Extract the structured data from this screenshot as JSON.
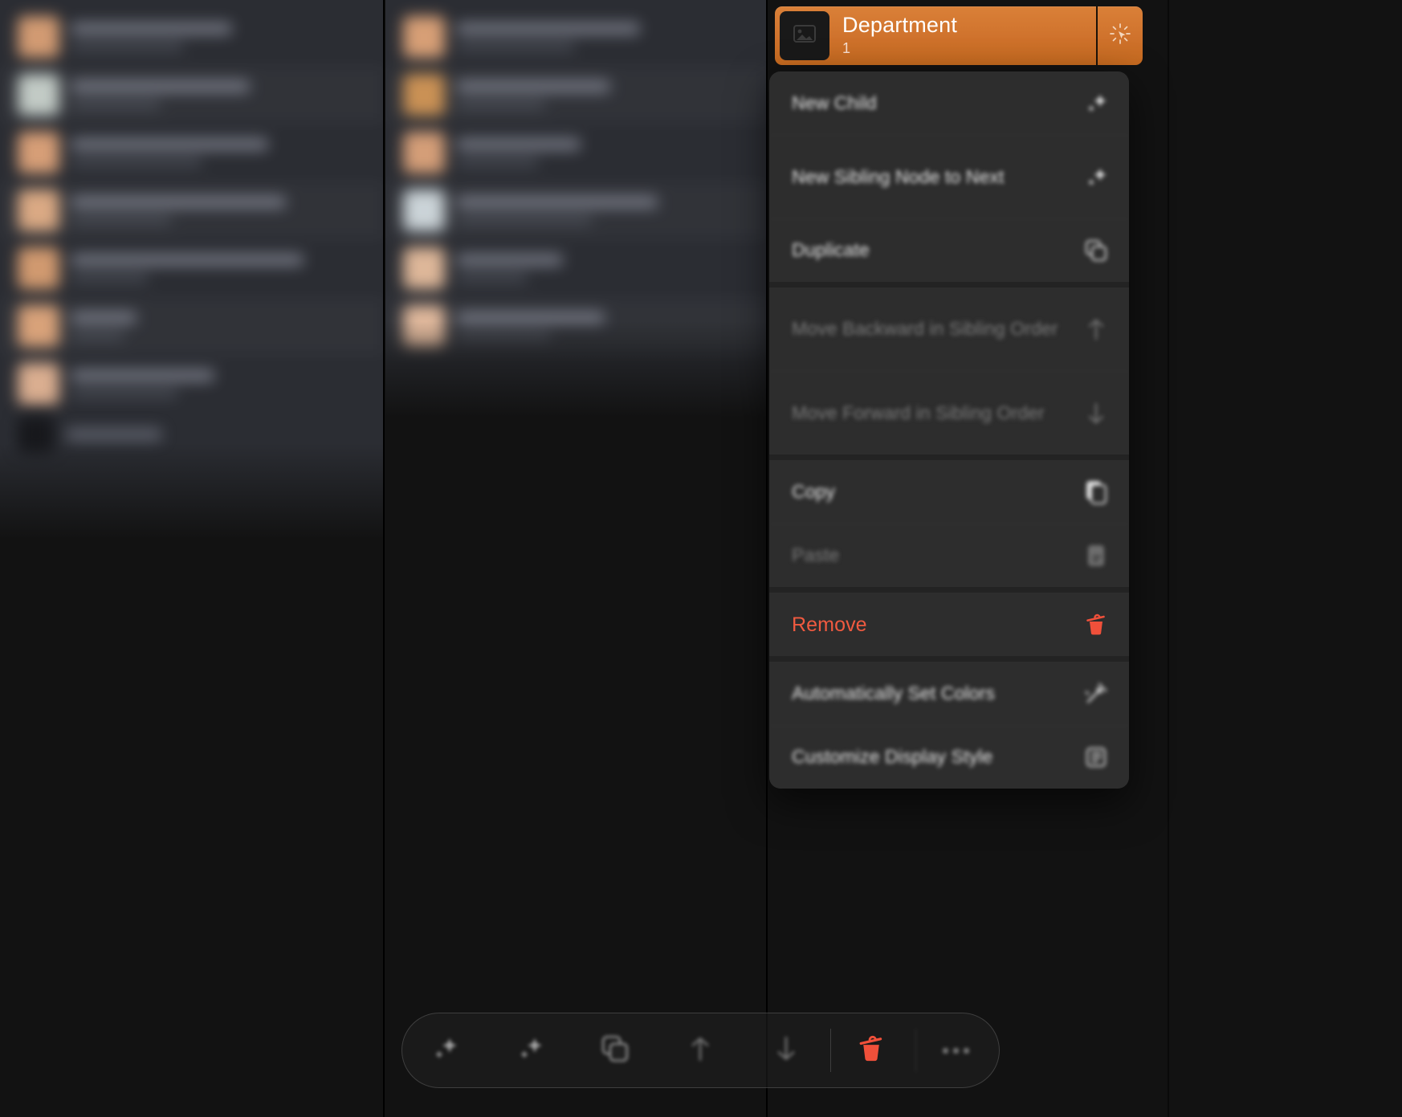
{
  "node_header": {
    "title": "Department",
    "subtitle": "1",
    "thumbnail_icon": "image-placeholder-icon",
    "cursor_icon": "cursor-click-icon",
    "accent_color": "#cf722c"
  },
  "context_menu": {
    "groups": [
      {
        "items": [
          {
            "label": "New Child",
            "icon": "sparkle-child-icon",
            "state": "enabled",
            "blurred": true
          },
          {
            "label": "New Sibling Node to Next",
            "icon": "sparkle-sibling-icon",
            "state": "enabled",
            "blurred": true
          },
          {
            "label": "Duplicate",
            "icon": "duplicate-icon",
            "state": "enabled",
            "blurred": true
          }
        ]
      },
      {
        "items": [
          {
            "label": "Move Backward in Sibling Order",
            "icon": "arrow-up-icon",
            "state": "disabled",
            "blurred": true
          },
          {
            "label": "Move Forward in Sibling Order",
            "icon": "arrow-down-icon",
            "state": "disabled",
            "blurred": true
          }
        ]
      },
      {
        "items": [
          {
            "label": "Copy",
            "icon": "copy-icon",
            "state": "enabled",
            "blurred": true
          },
          {
            "label": "Paste",
            "icon": "paste-icon",
            "state": "disabled",
            "blurred": true
          }
        ]
      },
      {
        "items": [
          {
            "label": "Remove",
            "icon": "trash-icon",
            "state": "destructive",
            "blurred": false
          }
        ]
      },
      {
        "items": [
          {
            "label": "Automatically Set Colors",
            "icon": "magic-wand-icon",
            "state": "enabled",
            "blurred": true
          },
          {
            "label": "Customize Display Style",
            "icon": "display-style-icon",
            "state": "enabled",
            "blurred": true
          }
        ]
      }
    ]
  },
  "bottom_toolbar": {
    "buttons": [
      {
        "icon": "sparkle-child-icon",
        "name": "new-child"
      },
      {
        "icon": "sparkle-sibling-icon",
        "name": "new-sibling"
      },
      {
        "icon": "duplicate-icon",
        "name": "duplicate"
      },
      {
        "icon": "arrow-up-icon",
        "name": "move-backward"
      },
      {
        "icon": "arrow-down-icon",
        "name": "move-forward"
      },
      {
        "icon": "trash-icon",
        "name": "remove"
      },
      {
        "icon": "ellipsis-icon",
        "name": "more"
      }
    ]
  },
  "colors": {
    "danger": "#f05a40",
    "menu_background": "#2d2d2d",
    "canvas_background": "#121212"
  }
}
